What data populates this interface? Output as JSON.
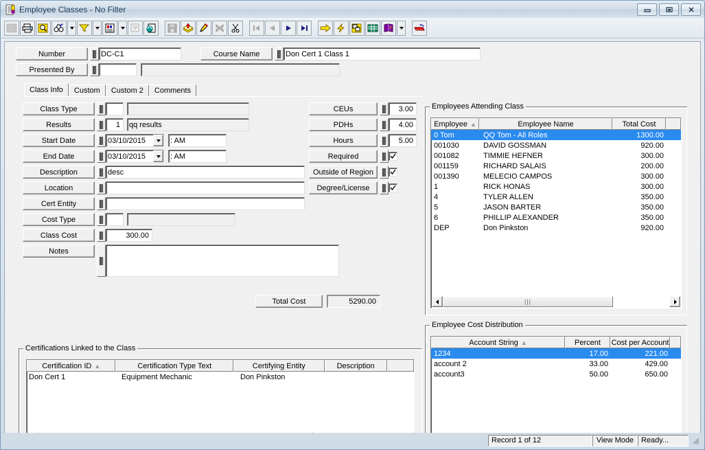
{
  "window": {
    "title": "Employee Classes - No Filter",
    "icon": "document-list-icon",
    "caption_buttons": [
      {
        "name": "minimize",
        "glyph": "minimize-icon"
      },
      {
        "name": "restore",
        "glyph": "restore-icon"
      },
      {
        "name": "close",
        "glyph": "close-icon"
      }
    ]
  },
  "toolbar": {
    "buttons": [
      {
        "name": "select-all",
        "icon": "dotted-rectangle-icon",
        "disabled": true
      },
      {
        "name": "print",
        "icon": "printer-icon",
        "disabled": false
      },
      {
        "name": "print-preview",
        "icon": "magnifier-page-icon",
        "disabled": false
      },
      {
        "name": "find",
        "icon": "binoculars-icon",
        "disabled": false
      },
      {
        "name": "find-dropdown",
        "icon": "chevron-down-icon",
        "disabled": false
      },
      {
        "name": "filter",
        "icon": "funnel-icon",
        "disabled": false
      },
      {
        "name": "filter-dropdown",
        "icon": "chevron-down-icon",
        "disabled": false
      },
      {
        "name": "report",
        "icon": "report-page-icon",
        "disabled": false
      },
      {
        "name": "report-dropdown",
        "icon": "chevron-down-icon",
        "disabled": false
      },
      {
        "name": "properties",
        "icon": "properties-icon",
        "disabled": true
      },
      {
        "name": "refresh",
        "icon": "refresh-page-icon",
        "disabled": false
      },
      {
        "name": "save",
        "icon": "floppy-disk-icon",
        "disabled": true
      },
      {
        "name": "new-record",
        "icon": "stack-add-icon",
        "disabled": false
      },
      {
        "name": "edit-record",
        "icon": "pencil-icon",
        "disabled": false
      },
      {
        "name": "delete-record",
        "icon": "x-delete-icon",
        "disabled": true
      },
      {
        "name": "cut",
        "icon": "scissors-icon",
        "disabled": false
      },
      {
        "name": "first-record",
        "icon": "first-record-icon",
        "disabled": true
      },
      {
        "name": "previous-record",
        "icon": "previous-record-icon",
        "disabled": true
      },
      {
        "name": "next-record",
        "icon": "next-record-icon",
        "disabled": false
      },
      {
        "name": "last-record",
        "icon": "last-record-icon",
        "disabled": false
      },
      {
        "name": "goto",
        "icon": "yellow-arrow-icon",
        "disabled": false
      },
      {
        "name": "quick-action",
        "icon": "lightning-bolt-icon",
        "disabled": false
      },
      {
        "name": "grid-layout",
        "icon": "grid-window-icon",
        "disabled": false
      },
      {
        "name": "spreadsheet",
        "icon": "spreadsheet-icon",
        "disabled": false
      },
      {
        "name": "help",
        "icon": "help-book-icon",
        "disabled": false
      },
      {
        "name": "help-dropdown",
        "icon": "chevron-down-icon",
        "disabled": false
      },
      {
        "name": "exit",
        "icon": "red-door-exit-icon",
        "disabled": false
      }
    ]
  },
  "header": {
    "number_label": "Number",
    "number_value": "DC-C1",
    "course_name_label": "Course Name",
    "course_name_value": "Don Cert 1 Class 1",
    "presented_by_label": "Presented By",
    "presented_by_code": "",
    "presented_by_value": ""
  },
  "tabs": [
    {
      "label": "Class Info",
      "active": true
    },
    {
      "label": "Custom",
      "active": false
    },
    {
      "label": "Custom 2",
      "active": false
    },
    {
      "label": "Comments",
      "active": false
    }
  ],
  "class_info": {
    "class_type_label": "Class Type",
    "class_type_code": "",
    "class_type_text": "",
    "results_label": "Results",
    "results_code": "1",
    "results_text": "qq results",
    "start_date_label": "Start Date",
    "start_date_value": "03/10/2015",
    "start_time_value": ":    AM",
    "end_date_label": "End Date",
    "end_date_value": "03/10/2015",
    "end_time_value": ":    AM",
    "description_label": "Description",
    "description_value": "desc",
    "location_label": "Location",
    "location_value": "",
    "cert_entity_label": "Cert Entity",
    "cert_entity_value": "",
    "cost_type_label": "Cost Type",
    "cost_type_code": "",
    "cost_type_text": "",
    "class_cost_label": "Class Cost",
    "class_cost_value": "300.00",
    "notes_label": "Notes",
    "notes_value": "",
    "ceus_label": "CEUs",
    "ceus_value": "3.00",
    "pdhs_label": "PDHs",
    "pdhs_value": "4.00",
    "hours_label": "Hours",
    "hours_value": "5.00",
    "required_label": "Required",
    "required_checked": true,
    "outside_of_region_label": "Outside of Region",
    "outside_of_region_checked": true,
    "degree_license_label": "Degree/License",
    "degree_license_checked": true,
    "total_cost_label": "Total Cost",
    "total_cost_value": "5290.00"
  },
  "employees_panel": {
    "legend": "Employees Attending Class",
    "columns": [
      "Employee",
      "Employee Name",
      "Total Cost"
    ],
    "sorted_column": 0,
    "rows": [
      {
        "employee": "0 Tom",
        "name": "QQ Tom - All Roles",
        "total_cost": "1300.00",
        "selected": true
      },
      {
        "employee": "001030",
        "name": "DAVID GOSSMAN",
        "total_cost": "920.00",
        "selected": false
      },
      {
        "employee": "001082",
        "name": "TIMMIE HEFNER",
        "total_cost": "300.00",
        "selected": false
      },
      {
        "employee": "001159",
        "name": "RICHARD SALAIS",
        "total_cost": "200.00",
        "selected": false
      },
      {
        "employee": "001390",
        "name": "MELECIO CAMPOS",
        "total_cost": "300.00",
        "selected": false
      },
      {
        "employee": "1",
        "name": "RICK HONAS",
        "total_cost": "300.00",
        "selected": false
      },
      {
        "employee": "4",
        "name": "TYLER ALLEN",
        "total_cost": "350.00",
        "selected": false
      },
      {
        "employee": "5",
        "name": "JASON BARTER",
        "total_cost": "350.00",
        "selected": false
      },
      {
        "employee": "6",
        "name": "PHILLIP ALEXANDER",
        "total_cost": "350.00",
        "selected": false
      },
      {
        "employee": "DEP",
        "name": "Don Pinkston",
        "total_cost": "920.00",
        "selected": false
      }
    ]
  },
  "cost_distribution_panel": {
    "legend": "Employee Cost Distribution",
    "columns": [
      "Account String",
      "Percent",
      "Cost per Account"
    ],
    "sorted_column": 0,
    "rows": [
      {
        "account": "1234",
        "percent": "17.00",
        "cost": "221.00",
        "selected": true
      },
      {
        "account": "account 2",
        "percent": "33.00",
        "cost": "429.00",
        "selected": false
      },
      {
        "account": "account3",
        "percent": "50.00",
        "cost": "650.00",
        "selected": false
      }
    ]
  },
  "certifications_panel": {
    "legend": "Certifications Linked to the Class",
    "columns": [
      "Certification ID",
      "Certification Type Text",
      "Certifying Entity",
      "Description"
    ],
    "sorted_column": 0,
    "rows": [
      {
        "id": "Don Cert 1",
        "type_text": "Equipment Mechanic",
        "entity": "Don Pinkston",
        "description": ""
      }
    ]
  },
  "statusbar": {
    "record": "Record 1 of 12",
    "mode": "View Mode",
    "state": "Ready..."
  },
  "colors": {
    "selection": "#2a8bef",
    "face": "#f0f0f0",
    "window_frame": "#7a9cb8"
  }
}
